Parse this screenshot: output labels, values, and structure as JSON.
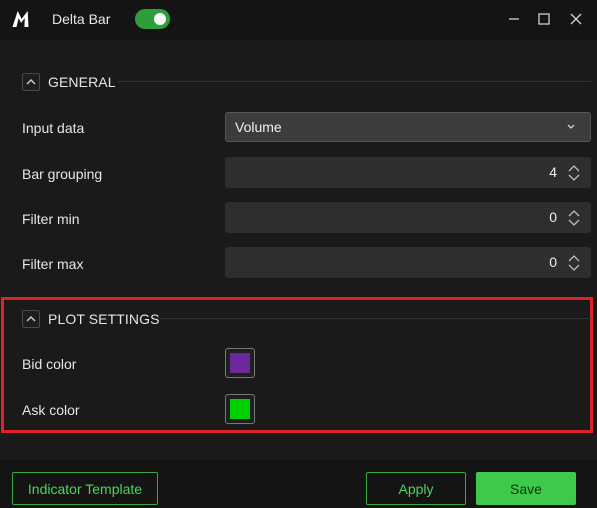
{
  "window": {
    "title": "Delta Bar",
    "enabled": true,
    "icons": {
      "logo": "m-logo-icon",
      "minimize": "minimize-icon",
      "maximize": "maximize-icon",
      "close": "close-icon"
    }
  },
  "general": {
    "title": "GENERAL",
    "input_data": {
      "label": "Input data",
      "value": "Volume"
    },
    "bar_grouping": {
      "label": "Bar grouping",
      "value": "4"
    },
    "filter_min": {
      "label": "Filter min",
      "value": "0"
    },
    "filter_max": {
      "label": "Filter max",
      "value": "0"
    }
  },
  "plot": {
    "title": "PLOT SETTINGS",
    "bid": {
      "label": "Bid color",
      "color": "#6a2a9c"
    },
    "ask": {
      "label": "Ask color",
      "color": "#00d000"
    }
  },
  "footer": {
    "template_label": "Indicator Template",
    "apply_label": "Apply",
    "save_label": "Save"
  },
  "colors": {
    "accent": "#3fc94a",
    "highlight": "#e0202a",
    "background": "#1a1a1a"
  }
}
